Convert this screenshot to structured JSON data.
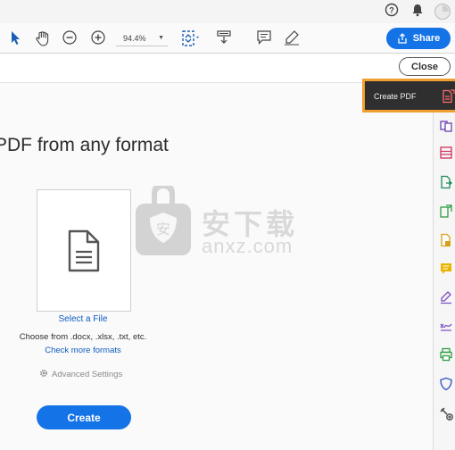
{
  "header": {
    "help_icon": "help-circle-icon",
    "bell_icon": "bell-icon",
    "avatar_icon": "user-avatar-icon"
  },
  "toolbar": {
    "zoom": "94.4%",
    "share_label": "Share"
  },
  "subbar": {
    "close_label": "Close"
  },
  "main": {
    "heading": "PDF from any format",
    "select_file": "Select a File",
    "choose_from": "Choose from .docx, .xlsx, .txt, etc.",
    "check_more": "Check more formats",
    "advanced": "Advanced Settings",
    "create_label": "Create"
  },
  "popup": {
    "label": "Create PDF"
  },
  "watermark": {
    "text": "安下载",
    "sub": "anxz.com"
  },
  "colors": {
    "accent": "#1473e6",
    "highlight": "#f0a030"
  }
}
